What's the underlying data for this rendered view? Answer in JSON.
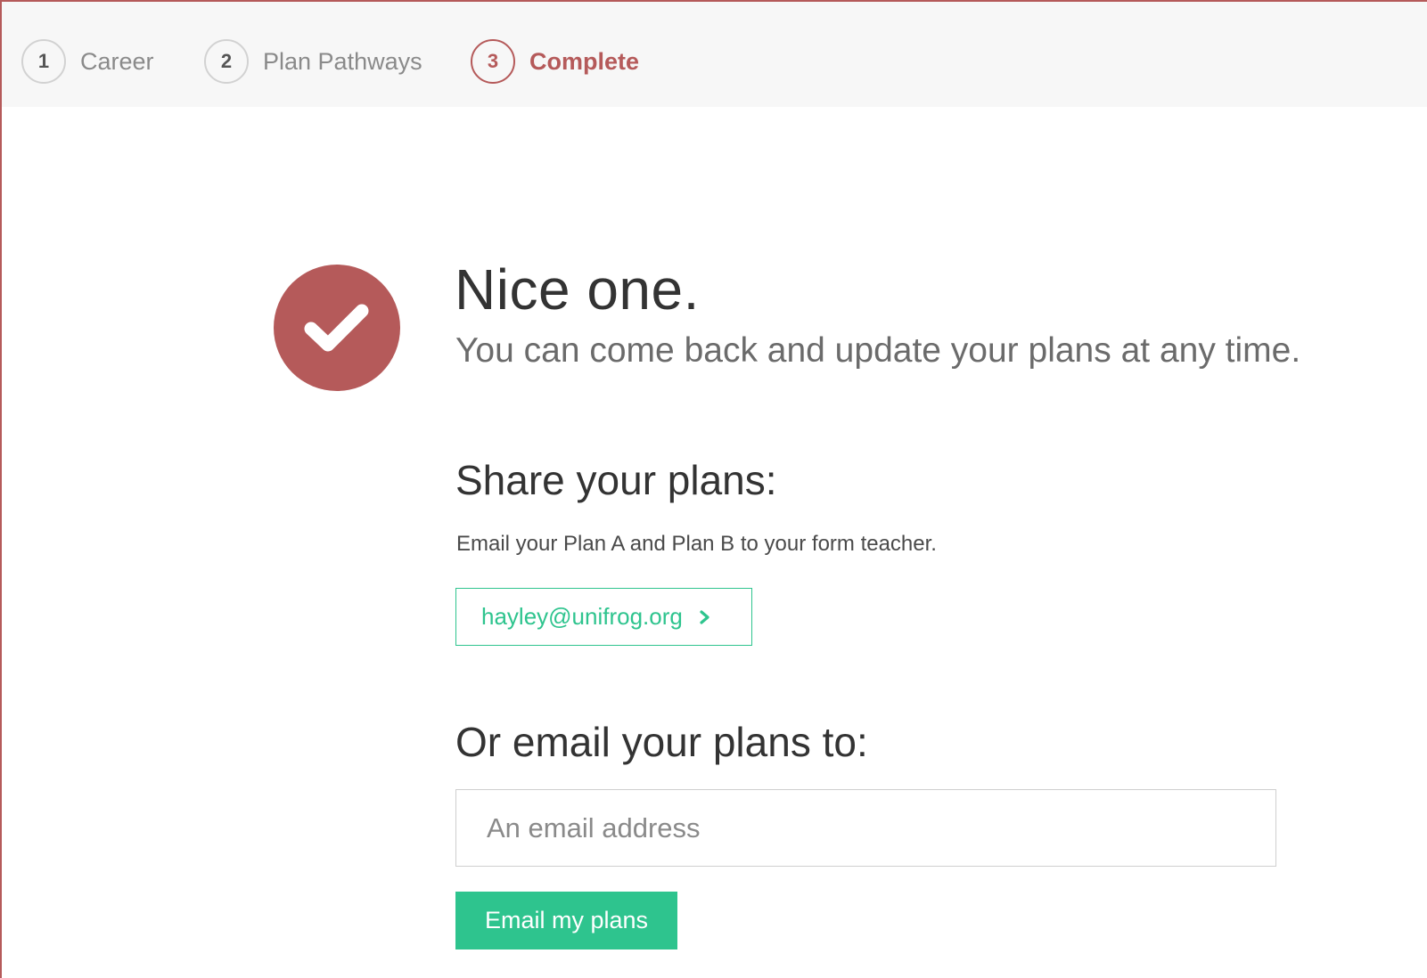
{
  "stepper": {
    "steps": [
      {
        "number": "1",
        "label": "Career",
        "state": "done"
      },
      {
        "number": "2",
        "label": "Plan Pathways",
        "state": "done"
      },
      {
        "number": "3",
        "label": "Complete",
        "state": "active"
      }
    ]
  },
  "colors": {
    "accent": "#b55a5a",
    "action": "#2ec48e",
    "step_border": "#d2d2d2"
  },
  "success": {
    "icon": "check-icon",
    "title": "Nice one.",
    "subtitle": "You can come back and update your plans at any time."
  },
  "share": {
    "heading": "Share your plans:",
    "description": "Email your Plan A and Plan B to your form teacher.",
    "teacher_email": "hayley@unifrog.org",
    "teacher_button_icon": "chevron-right-icon"
  },
  "email_other": {
    "heading": "Or email your plans to:",
    "input_value": "",
    "input_placeholder": "An email address",
    "submit_label": "Email my plans"
  }
}
